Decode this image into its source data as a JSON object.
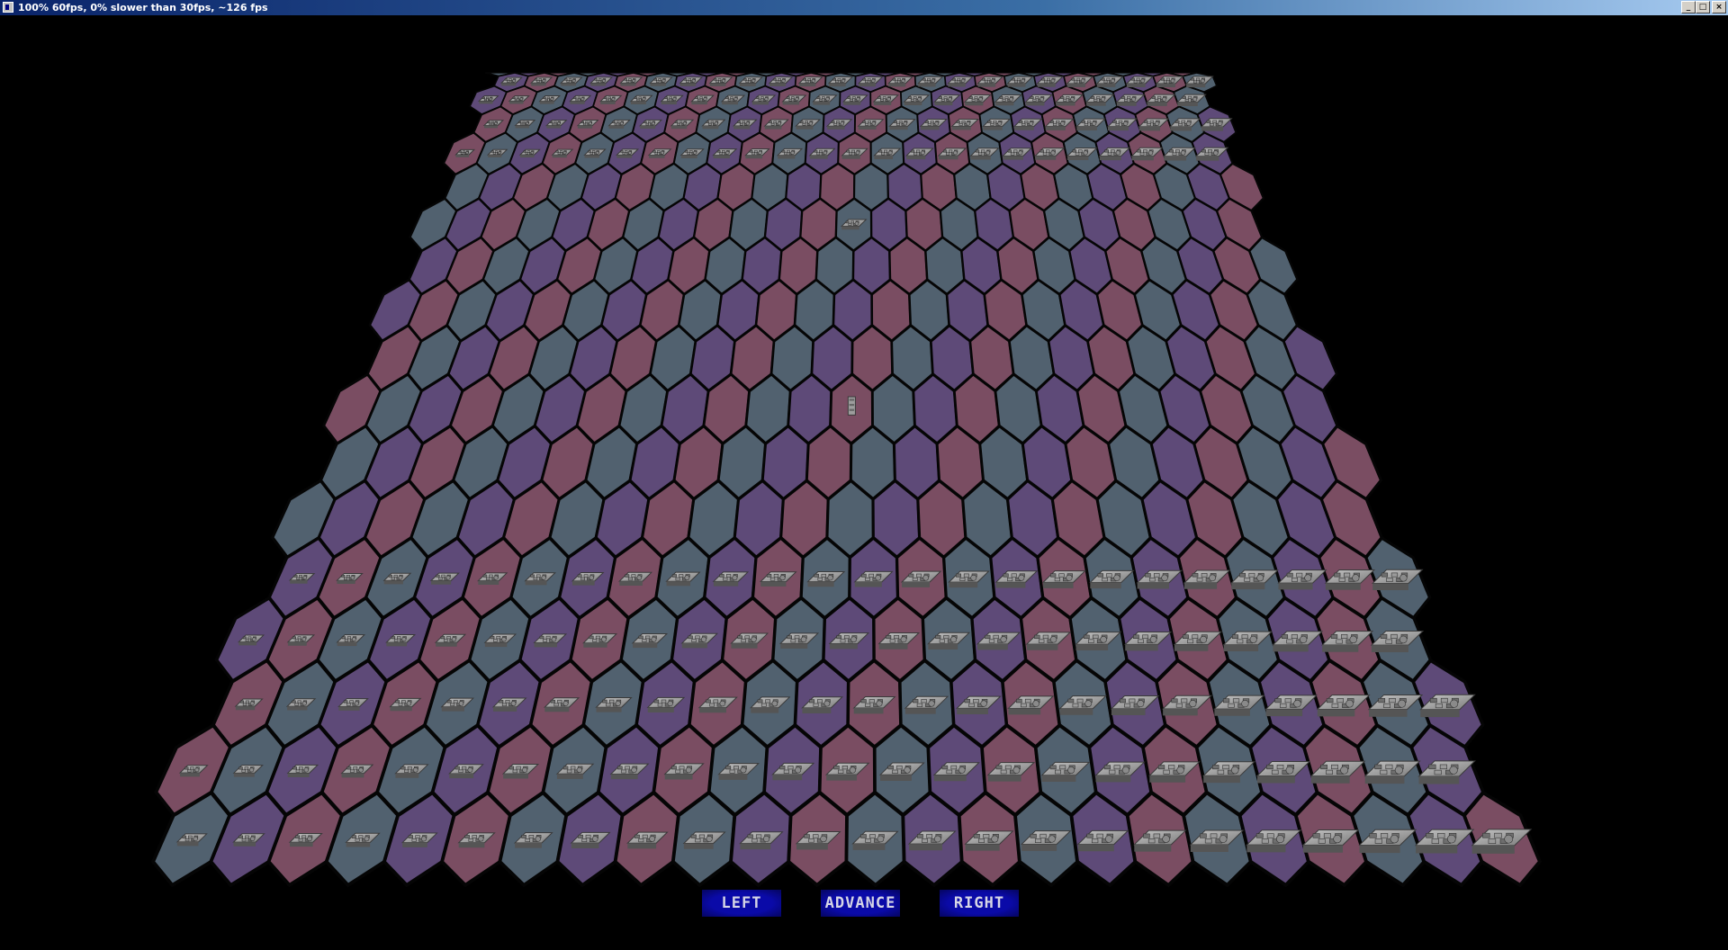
{
  "window": {
    "title": "100% 60fps, 0% slower than 30fps, ~126 fps",
    "minimize_label": "_",
    "maximize_label": "□",
    "close_label": "×"
  },
  "board": {
    "columns": 24,
    "rows": 18,
    "tile_colors": {
      "slate": "#51616f",
      "mauve": "#7a4d62",
      "violet": "#5e4a78"
    },
    "units_top_rows": 5,
    "units_bottom_rows": 5,
    "center_units": [
      {
        "name": "enemy-unit-center",
        "col": 12,
        "row": 6,
        "sprite": "tile-block"
      },
      {
        "name": "player-unit-center",
        "col": 12,
        "row": 10,
        "sprite": "tower"
      }
    ]
  },
  "controls": {
    "left_label": "LEFT",
    "advance_label": "ADVANCE",
    "right_label": "RIGHT"
  }
}
